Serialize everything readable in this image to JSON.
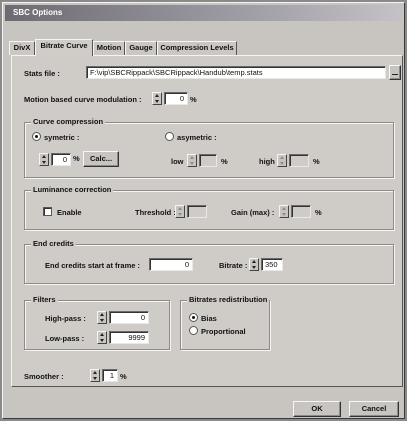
{
  "window": {
    "title": "SBC Options"
  },
  "tabs": [
    {
      "label": "DivX"
    },
    {
      "label": "Bitrate Curve"
    },
    {
      "label": "Motion"
    },
    {
      "label": "Gauge"
    },
    {
      "label": "Compression Levels"
    }
  ],
  "stats_file": {
    "label": "Stats file :",
    "value": "F:\\vip\\SBCRippack\\SBCRippack\\Handub\\temp.stats",
    "browse": ""
  },
  "motion": {
    "label": "Motion based curve modulation :",
    "value": "0",
    "unit": "%"
  },
  "curve_compression": {
    "title": "Curve compression",
    "symetric_label": "symetric :",
    "symetric_value": "0",
    "symetric_unit": "%",
    "calc_label": "Calc...",
    "asymetric_label": "asymetric :",
    "low_label": "low",
    "low_unit": "%",
    "high_label": "high",
    "high_unit": "%"
  },
  "luminance": {
    "title": "Luminance correction",
    "enable_label": "Enable",
    "threshold_label": "Threshold :",
    "gain_label": "Gain (max) :",
    "gain_unit": "%"
  },
  "end_credits": {
    "title": "End credits",
    "start_label": "End credits start at frame :",
    "start_value": "0",
    "bitrate_label": "Bitrate :",
    "bitrate_value": "350"
  },
  "filters": {
    "title": "Filters",
    "highpass_label": "High-pass :",
    "highpass_value": "0",
    "lowpass_label": "Low-pass :",
    "lowpass_value": "9999"
  },
  "redistribution": {
    "title": "Bitrates redistribution",
    "bias_label": "Bias",
    "proportional_label": "Proportional"
  },
  "smoother": {
    "label": "Smoother :",
    "value": "1",
    "unit": "%"
  },
  "buttons": {
    "ok": "OK",
    "cancel": "Cancel"
  }
}
